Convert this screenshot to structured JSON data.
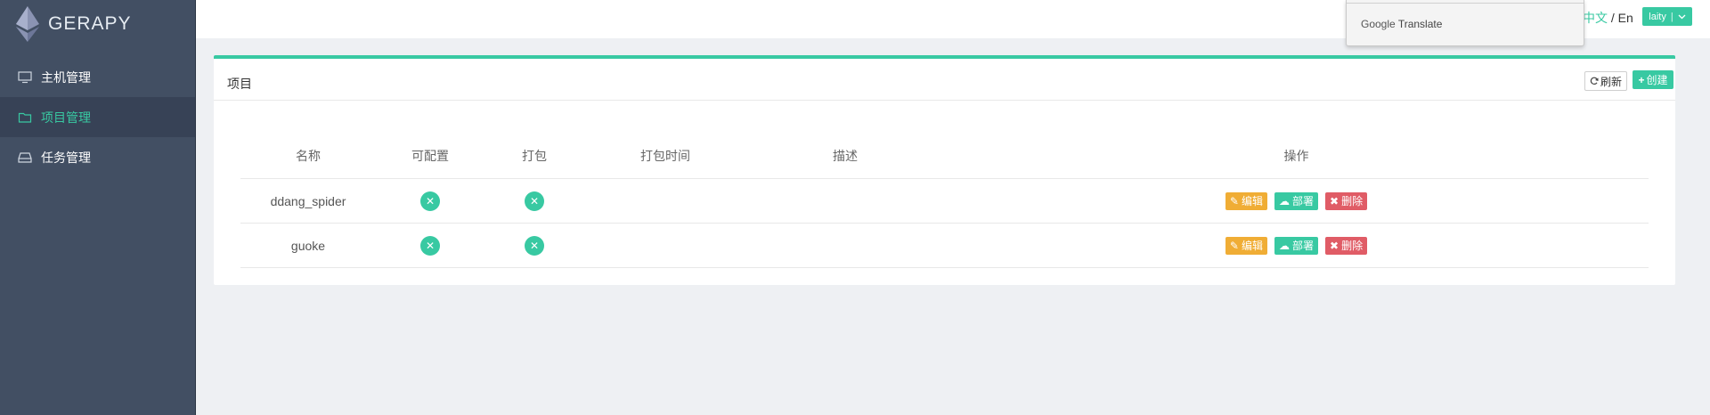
{
  "app": {
    "name": "GERAPY"
  },
  "sidebar": {
    "items": [
      {
        "label": "主机管理",
        "icon": "monitor-icon",
        "active": false
      },
      {
        "label": "项目管理",
        "icon": "folder-icon",
        "active": true
      },
      {
        "label": "任务管理",
        "icon": "inbox-icon",
        "active": false
      }
    ]
  },
  "header": {
    "lang_cn": "中文",
    "lang_sep": " / ",
    "lang_en": "En",
    "user": "laity"
  },
  "google_translate": {
    "brand": "Google",
    "label": "Translate"
  },
  "panel": {
    "title": "项目",
    "refresh_label": "刷新",
    "create_label": "创建"
  },
  "table": {
    "columns": [
      "名称",
      "可配置",
      "打包",
      "打包时间",
      "描述",
      "操作"
    ],
    "rows": [
      {
        "name": "ddang_spider",
        "configurable": false,
        "built": false,
        "built_at": "",
        "description": ""
      },
      {
        "name": "guoke",
        "configurable": false,
        "built": false,
        "built_at": "",
        "description": ""
      }
    ],
    "actions": {
      "edit": "编辑",
      "deploy": "部署",
      "delete": "删除"
    }
  },
  "colors": {
    "sidebar_bg": "#424f63",
    "accent": "#38c9a2",
    "edit": "#f0ad35",
    "delete": "#e05c66"
  }
}
